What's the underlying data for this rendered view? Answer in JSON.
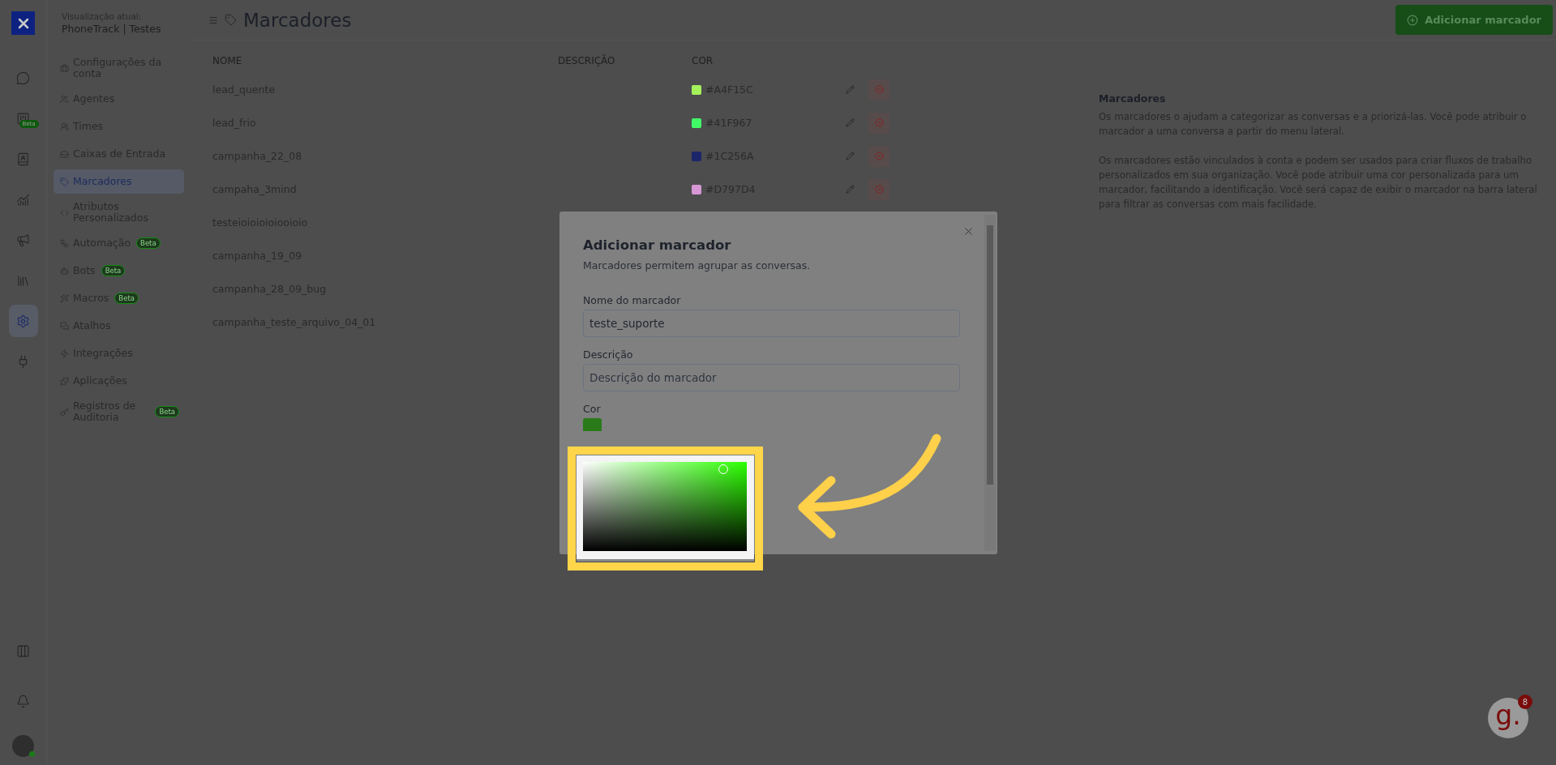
{
  "rail": {
    "items": [
      {
        "kind": "chat",
        "selected": false
      },
      {
        "kind": "kanban",
        "selected": false,
        "badge": "Beta"
      },
      {
        "kind": "contacts",
        "selected": false
      },
      {
        "kind": "reports",
        "selected": false
      },
      {
        "kind": "campaigns",
        "selected": false
      },
      {
        "kind": "library",
        "selected": false
      },
      {
        "kind": "settings",
        "selected": true
      },
      {
        "kind": "integrations",
        "selected": false
      }
    ],
    "bottom": [
      {
        "kind": "layout"
      },
      {
        "kind": "notifications"
      },
      {
        "kind": "avatar",
        "online": true
      }
    ]
  },
  "account": {
    "caption": "Visualização atual:",
    "name": "PhoneTrack | Testes"
  },
  "settings_nav": [
    {
      "label": "Configurações da conta",
      "kind": "account",
      "selected": false
    },
    {
      "label": "Agentes",
      "kind": "agents",
      "selected": false
    },
    {
      "label": "Times",
      "kind": "teams",
      "selected": false
    },
    {
      "label": "Caixas de Entrada",
      "kind": "inboxes",
      "selected": false
    },
    {
      "label": "Marcadores",
      "kind": "labels",
      "selected": true
    },
    {
      "label": "Atributos Personalizados",
      "kind": "attributes",
      "selected": false
    },
    {
      "label": "Automação",
      "kind": "automation",
      "selected": false,
      "badge": "Beta"
    },
    {
      "label": "Bots",
      "kind": "bots",
      "selected": false,
      "badge": "Beta"
    },
    {
      "label": "Macros",
      "kind": "macros",
      "selected": false,
      "badge": "Beta"
    },
    {
      "label": "Atalhos",
      "kind": "shortcuts",
      "selected": false
    },
    {
      "label": "Integrações",
      "kind": "integrations",
      "selected": false
    },
    {
      "label": "Aplicações",
      "kind": "apps",
      "selected": false
    },
    {
      "label": "Registros de Auditoria",
      "kind": "audit",
      "selected": false,
      "badge": "Beta"
    }
  ],
  "header": {
    "title": "Marcadores",
    "add_button": "Adicionar marcador"
  },
  "table": {
    "columns": [
      "NOME",
      "DESCRIÇÃO",
      "COR"
    ],
    "rows": [
      {
        "name": "lead_quente",
        "color": "#a4f15c",
        "color_code": "#A4F15C"
      },
      {
        "name": "lead_frio",
        "color": "#41f967",
        "color_code": "#41F967"
      },
      {
        "name": "campanha_22_08",
        "color": "#1c256a",
        "color_code": "#1C256A"
      },
      {
        "name": "campaha_3mind",
        "color": "#d797d4",
        "color_code": "#D797D4"
      },
      {
        "name": "testeioioioioiooioio"
      },
      {
        "name": "campanha_19_09"
      },
      {
        "name": "campanha_28_09_bug"
      },
      {
        "name": "campanha_teste_arquivo_04_01"
      }
    ]
  },
  "help": {
    "title": "Marcadores",
    "paragraphs": [
      "Os marcadores o ajudam a categorizar as conversas e a priorizá-las. Você pode atribuir o marcador a uma conversa a partir do menu lateral.",
      "Os marcadores estão vinculados à conta e podem ser usados para criar fluxos de trabalho personalizados em sua organização. Você pode atribuir uma cor personalizada para um marcador, facilitando a identificação. Você será capaz de exibir o marcador na barra lateral para filtrar as conversas com mais facilidade."
    ]
  },
  "modal": {
    "title": "Adicionar marcador",
    "subtitle": "Marcadores permitem agrupar as conversas.",
    "fields": [
      {
        "label": "Nome do marcador",
        "value": "teste_suporte"
      },
      {
        "label": "Descrição",
        "placeholder": "Descrição do marcador"
      }
    ],
    "color_label": "Cor"
  },
  "chat_widget": {
    "logo": "g.",
    "badge": "8"
  }
}
